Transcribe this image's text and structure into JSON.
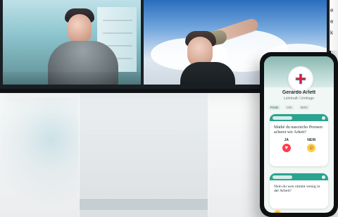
{
  "phone": {
    "profile_name": "Gerardo Arlett",
    "profile_subtitle": "Lehrkraft / Umfrage",
    "tabs": [
      "Posts",
      "Info",
      "Mehr"
    ],
    "card1": {
      "question": "Mathé du nascnicho Prensen acheret wir Arheit?",
      "answer_yes": "JA",
      "answer_no": "NEIN"
    },
    "card2": {
      "question": "Nein du wen nimmt wenig in der Arbeit?"
    }
  },
  "edge_fragments": {
    "line1": "e",
    "line2": "e",
    "line3": "k"
  },
  "icons": {
    "logo": "medical-cross-logo-icon",
    "heart": "heart-icon",
    "smile": "smile-icon"
  },
  "colors": {
    "teal": "#2aa38f",
    "heart": "#ff3b4a",
    "smile": "#ffcc4a"
  }
}
